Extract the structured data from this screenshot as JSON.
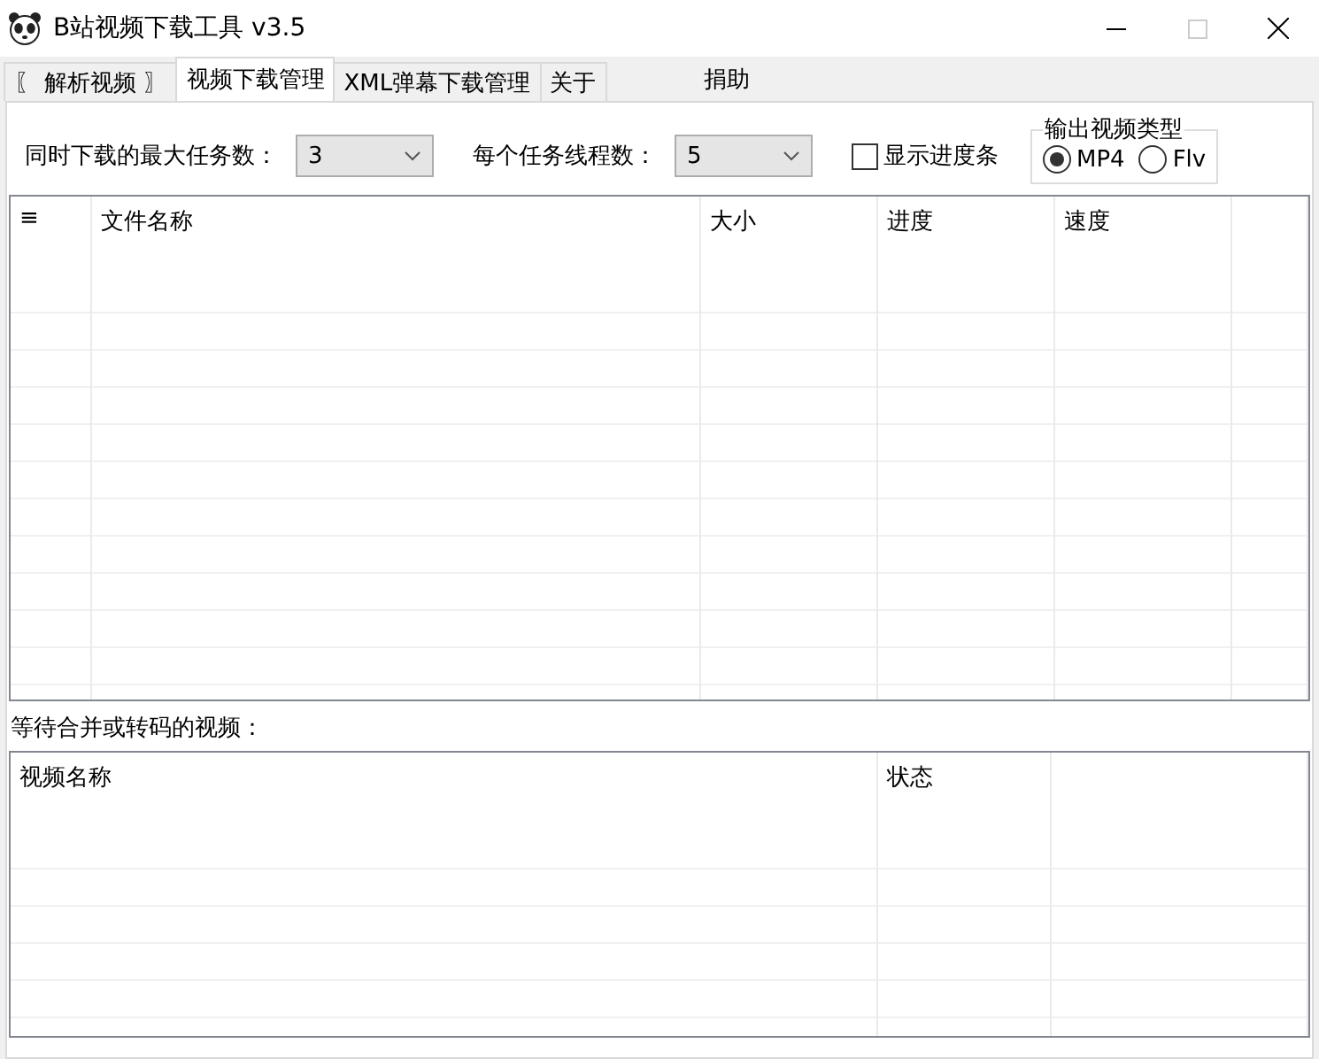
{
  "window": {
    "title": "B站视频下载工具 v3.5"
  },
  "tabs": [
    {
      "label": "〖 解析视频 〗",
      "selected": false
    },
    {
      "label": "视频下载管理",
      "selected": true
    },
    {
      "label": "XML弹幕下载管理",
      "selected": false
    },
    {
      "label": "关于",
      "selected": false
    }
  ],
  "donate": "捐助",
  "settings": {
    "max_tasks": {
      "label": "同时下载的最大任务数：",
      "value": "3"
    },
    "threads": {
      "label": "每个任务线程数：",
      "value": "5"
    },
    "show_progress": {
      "label": "显示进度条",
      "checked": false
    },
    "output_type": {
      "title": "输出视频类型",
      "options": [
        {
          "label": "MP4",
          "selected": true
        },
        {
          "label": "Flv",
          "selected": false
        }
      ]
    }
  },
  "download_table": {
    "columns": [
      "≡",
      "文件名称",
      "大小",
      "进度",
      "速度"
    ]
  },
  "merge_label": "等待合并或转码的视频：",
  "merge_table": {
    "columns": [
      "视频名称",
      "状态"
    ]
  }
}
